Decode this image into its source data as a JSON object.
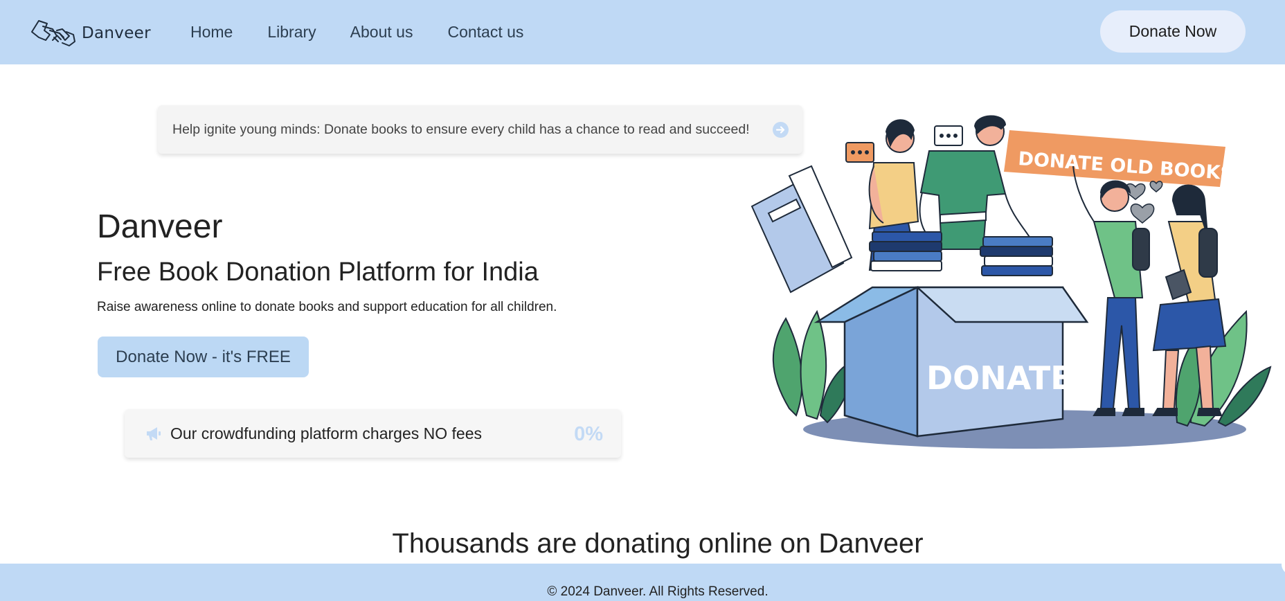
{
  "header": {
    "brand": "Danveer",
    "nav": [
      {
        "label": "Home"
      },
      {
        "label": "Library"
      },
      {
        "label": "About us"
      },
      {
        "label": "Contact us"
      }
    ],
    "donate_button": "Donate Now"
  },
  "banner": {
    "text": "Help ignite young minds: Donate books to ensure every child has a chance to read and succeed!",
    "icon": "arrow-right-circle-icon"
  },
  "hero": {
    "title": "Danveer",
    "subtitle": "Free Book Donation Platform for India",
    "description": "Raise awareness online to donate books and support education for all children.",
    "cta": "Donate Now - it's FREE"
  },
  "fees_card": {
    "icon": "megaphone-icon",
    "text": "Our crowdfunding platform charges NO fees",
    "value": "0%"
  },
  "illustration": {
    "banner_text": "DONATE OLD BOOKS",
    "box_text": "DONATE"
  },
  "section": {
    "heading": "Thousands are donating online on Danveer"
  },
  "footer": {
    "text": "© 2024 Danveer. All Rights Reserved."
  },
  "colors": {
    "header_bg": "#bfd9f5",
    "accent": "#bcd8f4",
    "light_button": "#e7eefb",
    "card_bg": "#f4f4f4",
    "text": "#222222"
  }
}
